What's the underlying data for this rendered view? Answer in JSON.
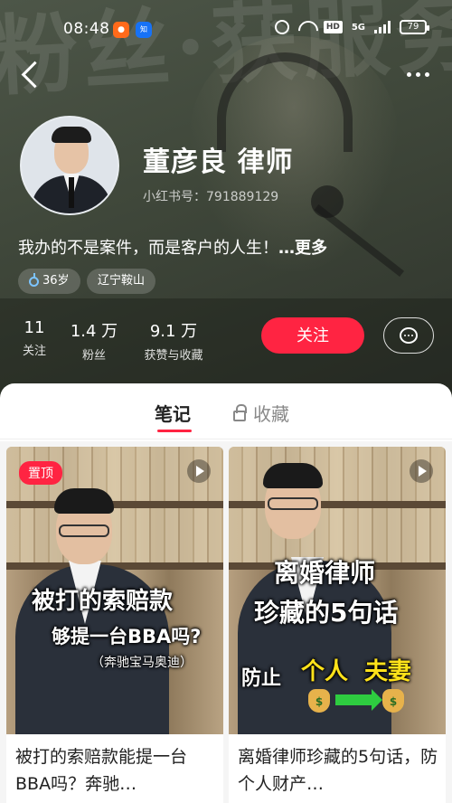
{
  "status_bar": {
    "time": "08:48",
    "network_type": "5G",
    "hd_badge": "HD",
    "battery_level": "79"
  },
  "hero": {
    "background_text": "粉丝·获服务"
  },
  "profile": {
    "name": "董彦良 律师",
    "red_id": "小红书号：791889129",
    "bio": "我办的不是案件，而是客户的人生！",
    "bio_more": "…更多",
    "tags": {
      "age": "36岁",
      "location": "辽宁鞍山"
    },
    "stats": [
      {
        "value": "11",
        "label": "关注"
      },
      {
        "value": "1.4 万",
        "label": "粉丝"
      },
      {
        "value": "9.1 万",
        "label": "获赞与收藏"
      }
    ],
    "follow_label": "关注"
  },
  "tabs": {
    "notes": "笔记",
    "collections": "收藏"
  },
  "notes": [
    {
      "pin_label": "置顶",
      "cover_text": [
        "被打的索赔款",
        "够提一台BBA吗?",
        "（奔驰宝马奥迪）"
      ],
      "title": "被打的索赔款能提一台BBA吗？奔驰…"
    },
    {
      "cover_text": [
        "离婚律师",
        "珍藏的5句话",
        "防止",
        "个人",
        "夫妻"
      ],
      "title": "离婚律师珍藏的5句话，防个人财产…"
    }
  ],
  "icons": {
    "back": "back-arrow-icon",
    "more": "more-dots-icon",
    "message": "chat-bubble-icon",
    "lock": "lock-icon",
    "play": "play-icon",
    "gender": "male-icon",
    "money": "money-bag-icon"
  },
  "colors": {
    "accent": "#ff2442",
    "header_bg": "#4a5246"
  }
}
